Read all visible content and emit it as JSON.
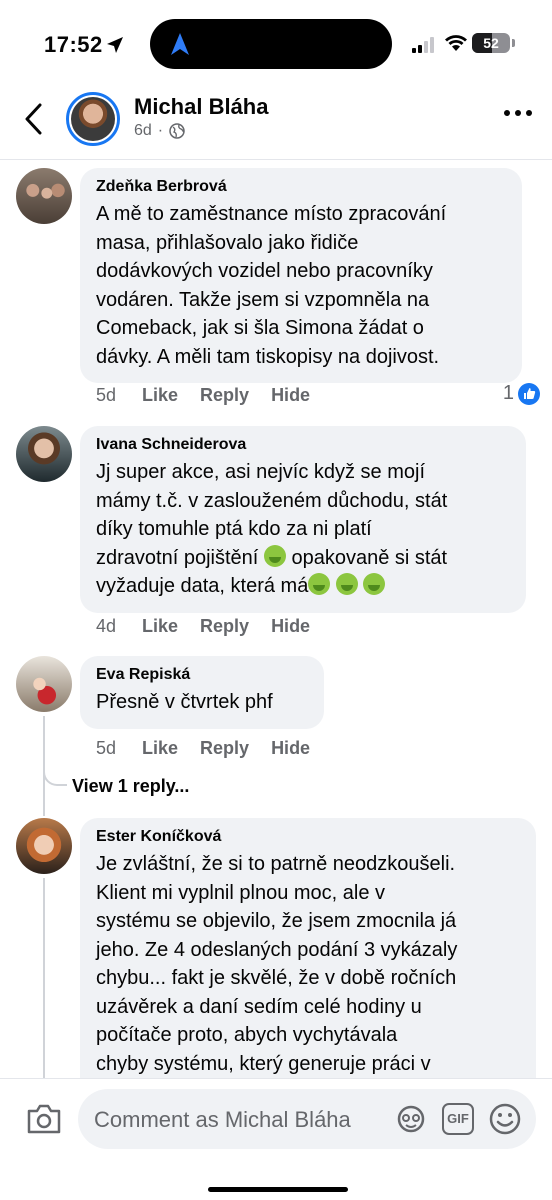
{
  "status_bar": {
    "time": "17:52",
    "battery": "52",
    "battery_level": 0.52
  },
  "header": {
    "name": "Michal Bláha",
    "age": "6d",
    "dot": "·",
    "back_icon": "chevron-left-icon",
    "privacy_icon": "globe-icon",
    "more_icon": "more-horizontal-icon"
  },
  "comments": [
    {
      "author": "Zdeňka Berbrová",
      "lines": [
        "A mě to zaměstnance místo zpracování",
        "masa, přihlašovalo jako řidiče",
        "dodávkových vozidel nebo pracovníky",
        "vodáren. Takže jsem si vzpomněla na",
        "Comeback, jak si šla Simona žádat o",
        "dávky. A měli tam tiskopisy na dojivost."
      ],
      "age": "5d",
      "like": "Like",
      "reply": "Reply",
      "hide": "Hide",
      "reaction_count": "1"
    },
    {
      "author": "Ivana Schneiderova",
      "lines": [
        "Jj super akce, asi nejvíc když se mojí",
        "mámy t.č. v zaslouženém důchodu, stát",
        "díky tomuhle ptá kdo za ni platí",
        "zdravotní pojištění",
        "opakovaně si stát",
        "vyžaduje data, která má"
      ],
      "emoji": "nauseated-face-emoji",
      "age": "4d",
      "like": "Like",
      "reply": "Reply",
      "hide": "Hide"
    },
    {
      "author": "Eva Repiská",
      "lines": [
        "Přesně v čtvrtek phf"
      ],
      "age": "5d",
      "like": "Like",
      "reply": "Reply",
      "hide": "Hide",
      "view_replies": "View 1 reply..."
    },
    {
      "author": "Ester Koníčková",
      "lines": [
        "Je zvláštní, že si to patrně neodzkoušeli.",
        "Klient mi vyplnil plnou moc, ale v",
        "systému se objevilo, že jsem zmocnila já",
        "jeho. Ze 4 odeslaných podání 3 vykázaly",
        "chybu... fakt je skvělé, že v době ročních",
        "uzávěrek a daní sedím celé hodiny u",
        "počítače proto, abych vychytávala",
        "chyby systému, který generuje práci v"
      ]
    }
  ],
  "composer": {
    "placeholder": "Comment as Michal Bláha",
    "gif_label": "GIF"
  },
  "colors": {
    "accent": "#1877f2",
    "bubble": "#f0f2f5",
    "secondary_text": "#65676b"
  }
}
